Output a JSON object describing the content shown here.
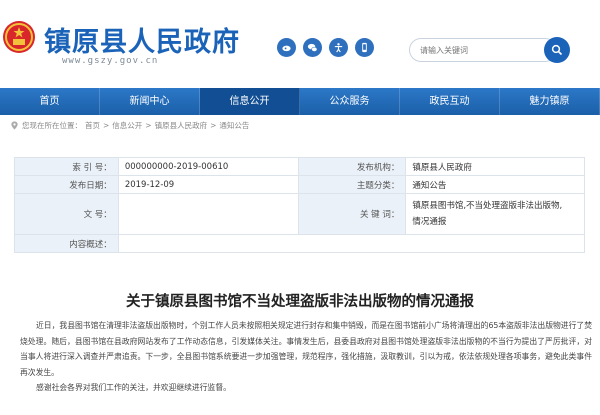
{
  "header": {
    "site_title": "镇原县人民政府",
    "site_url": "www.gszy.gov.cn",
    "emblem_icon": "national-emblem-icon",
    "icons": [
      "weibo-icon",
      "wechat-icon",
      "accessibility-icon",
      "mobile-icon"
    ],
    "search": {
      "placeholder": "请输入关键词"
    },
    "brand_color": "#1a63b8"
  },
  "nav": {
    "items": [
      "首页",
      "新闻中心",
      "信息公开",
      "公众服务",
      "政民互动",
      "魅力镇原"
    ],
    "active_index": 2
  },
  "breadcrumb": {
    "prefix": "您现在所在位置：",
    "items": [
      "首页",
      "信息公开",
      "镇原县人民政府",
      "通知公告"
    ],
    "separator": ">"
  },
  "info_table": {
    "index_label": "索 引 号：",
    "index_value": "000000000-2019-00610",
    "issuer_label": "发布机构：",
    "issuer_value": "镇原县人民政府",
    "date_label": "发布日期：",
    "date_value": "2019-12-09",
    "category_label": "主题分类：",
    "category_value": "通知公告",
    "doc_label": "文 号：",
    "doc_value": "",
    "keywords_label": "关 键 词：",
    "keywords_line1": "镇原县图书馆,不当处理盗版非法出版物,",
    "keywords_line2": "情况通报",
    "summary_label": "内容概述：",
    "summary_value": ""
  },
  "article": {
    "title": "关于镇原县图书馆不当处理盗版非法出版物的情况通报",
    "paragraphs": [
      "近日，我县图书馆在清理非法盗版出版物时，个别工作人员未按照相关规定进行封存和集中销毁，而是在图书馆前小广场将清理出的65本盗版非法出版物进行了焚烧处理。随后，县图书馆在县政府网站发布了工作动态信息，引发媒体关注。事情发生后，县委县政府对县图书馆处理盗版非法出版物的不当行为提出了严厉批评，对当事人将进行深入调查并严肃追责。下一步，全县图书馆系统要进一步加强管理，规范程序，强化措施，汲取教训，引以为戒，依法依规处理各项事务，避免此类事件再次发生。",
      "感谢社会各界对我们工作的关注，并欢迎继续进行监督。"
    ]
  }
}
